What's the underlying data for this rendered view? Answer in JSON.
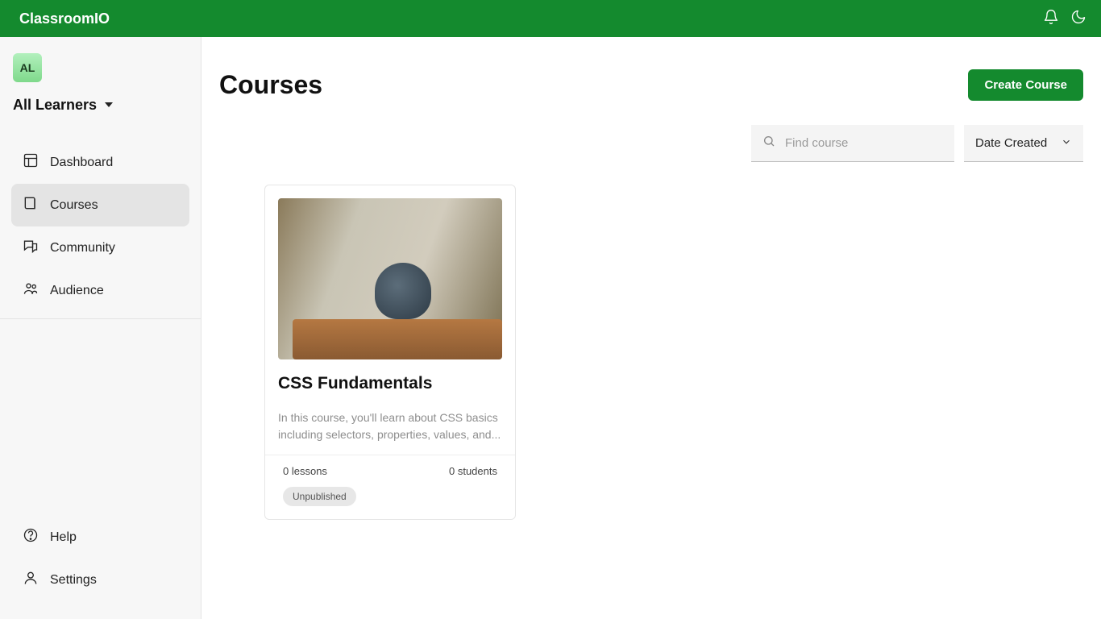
{
  "brand": "ClassroomIO",
  "org": {
    "avatar_letters": "AL",
    "name": "All Learners"
  },
  "nav": {
    "dashboard": "Dashboard",
    "courses": "Courses",
    "community": "Community",
    "audience": "Audience",
    "help": "Help",
    "settings": "Settings"
  },
  "page": {
    "title": "Courses",
    "create_label": "Create Course"
  },
  "search": {
    "placeholder": "Find course"
  },
  "sort": {
    "selected": "Date Created"
  },
  "courses": [
    {
      "title": "CSS Fundamentals",
      "description": "In this course, you'll learn about CSS basics including selectors, properties, values, and...",
      "lessons_text": "0 lessons",
      "students_text": "0 students",
      "status": "Unpublished"
    }
  ]
}
